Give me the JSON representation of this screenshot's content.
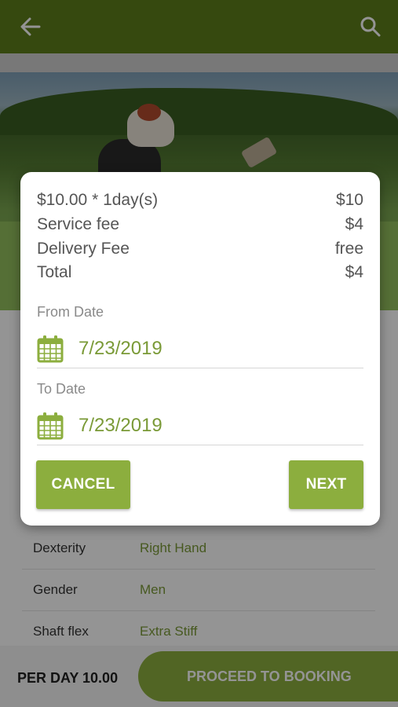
{
  "colors": {
    "primary": "#5e7f1b",
    "accent": "#8cae3e",
    "value_text": "#7a9a37"
  },
  "appbar": {
    "back_icon": "arrow-left-icon",
    "search_icon": "search-icon"
  },
  "details": [
    {
      "label": "Dexterity",
      "value": "Right Hand"
    },
    {
      "label": "Gender",
      "value": "Men"
    },
    {
      "label": "Shaft flex",
      "value": "Extra Stiff"
    }
  ],
  "bottom_bar": {
    "per_day": "PER DAY 10.00",
    "proceed_label": "PROCEED TO BOOKING"
  },
  "dialog": {
    "lines": [
      {
        "label": "$10.00 * 1day(s)",
        "value": "$10"
      },
      {
        "label": "Service fee",
        "value": "$4"
      },
      {
        "label": "Delivery Fee",
        "value": "free"
      },
      {
        "label": "Total",
        "value": "$4"
      }
    ],
    "from_label": "From Date",
    "from_value": "7/23/2019",
    "to_label": "To Date",
    "to_value": "7/23/2019",
    "calendar_icon": "calendar-icon",
    "cancel_label": "CANCEL",
    "next_label": "NEXT"
  }
}
